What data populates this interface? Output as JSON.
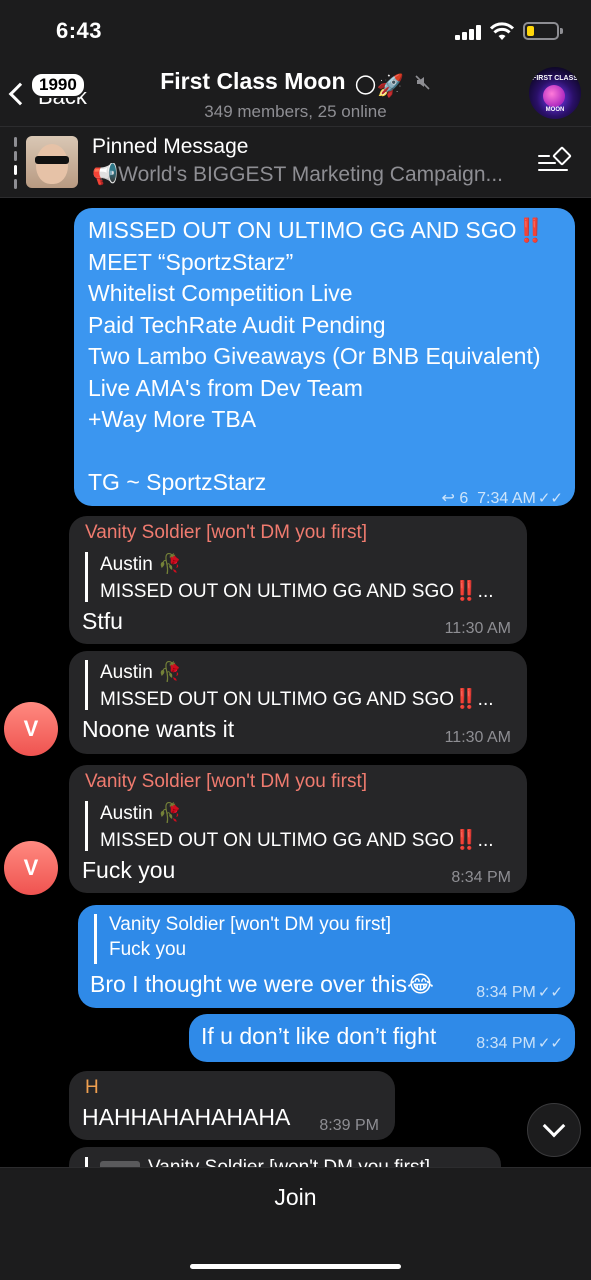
{
  "status": {
    "time": "6:43"
  },
  "header": {
    "badge": "1990",
    "back_label": "Back",
    "title": "First Class Moon",
    "title_emojis": "🌕🚀",
    "subtitle": "349 members, 25 online",
    "avatar_text_top": "FIRST CLASS",
    "avatar_text_bottom": "MOON"
  },
  "pinned": {
    "title": "Pinned Message",
    "text": "📢World's BIGGEST Marketing Campaign..."
  },
  "messages": {
    "m1": {
      "lines": "MISSED OUT ON ULTIMO GG AND SGO‼️\nMEET “SportzStarz”\nWhitelist Competition Live\nPaid TechRate Audit Pending\nTwo Lambo Giveaways (Or BNB Equivalent)\nLive AMA's from Dev Team\n+Way More TBA\n\nTG ~ SportzStarz",
      "replies": "6",
      "time": "7:34 AM"
    },
    "m2": {
      "sender": "Vanity Soldier [won't DM you first]",
      "reply_name": "Austin 🥀",
      "reply_text": "MISSED OUT ON ULTIMO GG AND SGO‼️...",
      "text": "Stfu",
      "time": "11:30 AM"
    },
    "m3": {
      "reply_name": "Austin 🥀",
      "reply_text": "MISSED OUT ON ULTIMO GG AND SGO‼️...",
      "text": "Noone wants it",
      "time": "11:30 AM",
      "avatar": "V"
    },
    "m4": {
      "sender": "Vanity Soldier [won't DM you first]",
      "reply_name": "Austin 🥀",
      "reply_text": "MISSED OUT ON ULTIMO GG AND SGO‼️...",
      "text": "Fuck you",
      "time": "8:34 PM",
      "avatar": "V"
    },
    "m5": {
      "reply_name": "Vanity Soldier [won't DM you first]",
      "reply_text": "Fuck you",
      "text": "Bro I thought we were over this😂",
      "time": "8:34 PM"
    },
    "m6": {
      "text": "If u don’t like don’t fight",
      "time": "8:34 PM"
    },
    "m7": {
      "sender": "H",
      "text": "HAHHAHAHAHAHA",
      "time": "8:39 PM"
    },
    "m8": {
      "reply_name": "Vanity Soldier [won't DM you first]"
    }
  },
  "bottom": {
    "join_label": "Join"
  },
  "colors": {
    "outgoing": "#3b96f0",
    "incoming": "#262628",
    "sender_name": "#f07b6f",
    "sender_h": "#f0a050"
  }
}
